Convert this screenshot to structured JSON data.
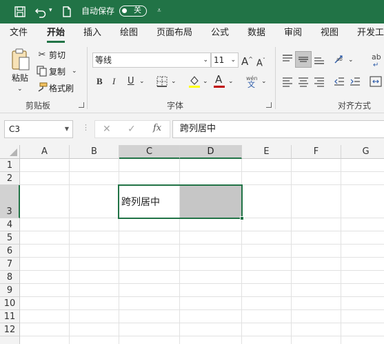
{
  "quick_access": {
    "save_icon": "save-icon",
    "undo_icon": "undo-icon",
    "new_icon": "new-document-icon",
    "autosave_label": "自动保存",
    "autosave_state": "关"
  },
  "tabs": [
    "文件",
    "开始",
    "插入",
    "绘图",
    "页面布局",
    "公式",
    "数据",
    "审阅",
    "视图",
    "开发工"
  ],
  "ribbon": {
    "clipboard": {
      "paste": "粘贴",
      "cut": "剪切",
      "copy": "复制",
      "format_painter": "格式刷",
      "group_label": "剪贴板"
    },
    "font": {
      "font_name": "等线",
      "font_size": "11",
      "bold": "B",
      "italic": "I",
      "underline": "U",
      "phonetic_top": "wén",
      "phonetic_bottom": "文",
      "grow_font": "A",
      "shrink_font": "A",
      "font_color_letter": "A",
      "group_label": "字体"
    },
    "alignment": {
      "group_label": "对齐方式",
      "wrap_label": "ab"
    },
    "colors": {
      "accent": "#217346",
      "highlight": "#ffff00",
      "font_color": "#c00000"
    }
  },
  "formula_bar": {
    "name_box": "C3",
    "cancel": "✕",
    "enter": "✓",
    "fx": "fx",
    "value": "跨列居中"
  },
  "sheet": {
    "columns": [
      "A",
      "B",
      "C",
      "D",
      "E",
      "F",
      "G"
    ],
    "rows": [
      "1",
      "2",
      "3",
      "4",
      "5",
      "6",
      "7",
      "8",
      "9",
      "10",
      "11",
      "12"
    ],
    "active_cell": "C3",
    "cell_c3": "跨列居中",
    "selection_fill": "#c6c6c6"
  }
}
